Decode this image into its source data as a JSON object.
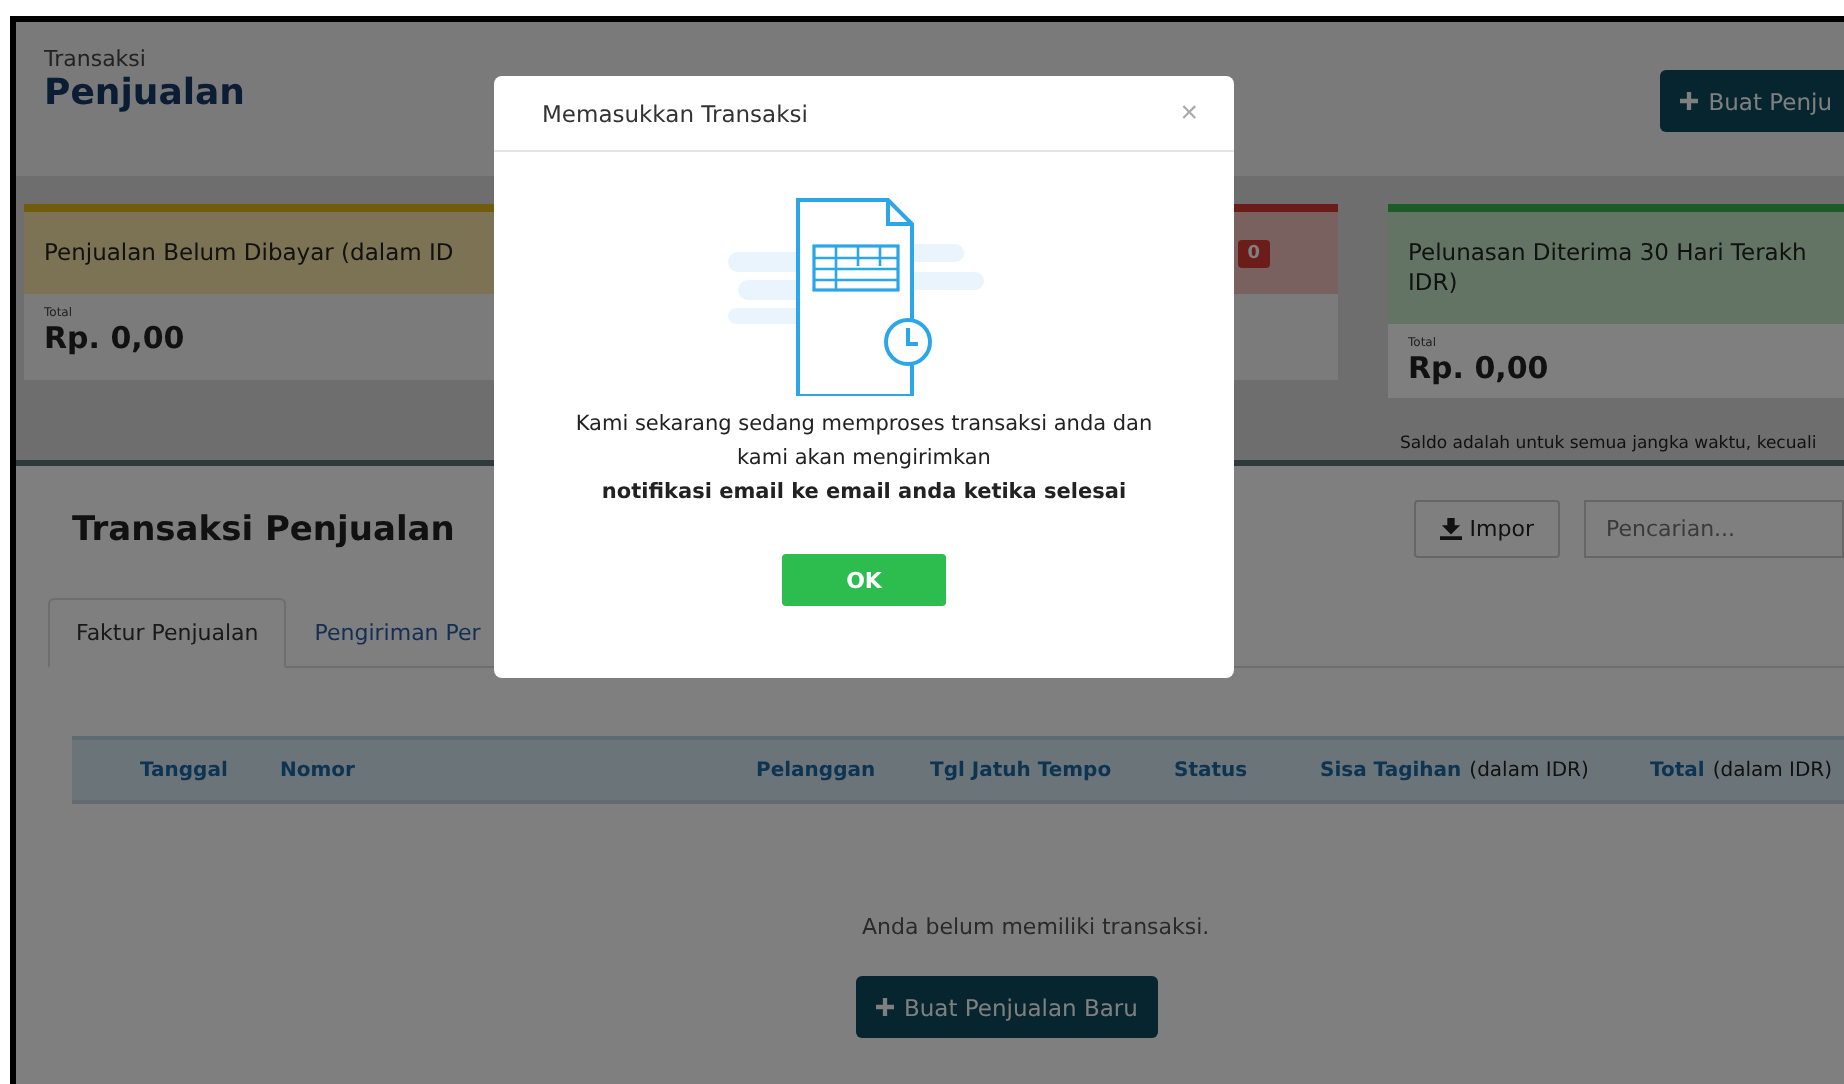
{
  "header": {
    "breadcrumb": "Transaksi",
    "title": "Penjualan",
    "create_button": "Buat Penju"
  },
  "summary_cards": [
    {
      "kind": "warning",
      "title_lines": [
        "Penjualan Belum Dibayar (dalam ID"
      ],
      "total_label": "Total",
      "total": "Rp. 0,00"
    },
    {
      "kind": "danger",
      "badge": "0"
    },
    {
      "kind": "success",
      "title_lines": [
        "Pelunasan Diterima 30 Hari Terakh",
        "IDR)"
      ],
      "total_label": "Total",
      "total": "Rp. 0,00"
    }
  ],
  "balance_note": "Saldo adalah untuk semua jangka waktu, kecuali",
  "transactions": {
    "title": "Transaksi Penjualan",
    "import_button": "Impor",
    "search": {
      "placeholder": "Pencarian..."
    },
    "tabs": [
      {
        "label": "Faktur Penjualan",
        "selected": true
      },
      {
        "label": "Pengiriman Per",
        "selected": false
      }
    ],
    "table": {
      "columns": [
        {
          "label": "Tanggal"
        },
        {
          "label": "Nomor"
        },
        {
          "label": "Pelanggan"
        },
        {
          "label": "Tgl Jatuh Tempo"
        },
        {
          "label": "Status"
        },
        {
          "label": "Sisa Tagihan",
          "note": "(dalam IDR)"
        },
        {
          "label": "Total",
          "note": "(dalam IDR)"
        }
      ]
    },
    "empty_message": "Anda belum memiliki transaksi.",
    "create_button": "Buat Penjualan Baru"
  },
  "dialog": {
    "title": "Memasukkan Transaksi",
    "close": "×",
    "message_lines": [
      "Kami sekarang sedang memproses transaksi anda dan",
      "kami akan mengirimkan",
      "**notifikasi email ke email anda ketika selesai**"
    ],
    "ok_button": "OK"
  }
}
